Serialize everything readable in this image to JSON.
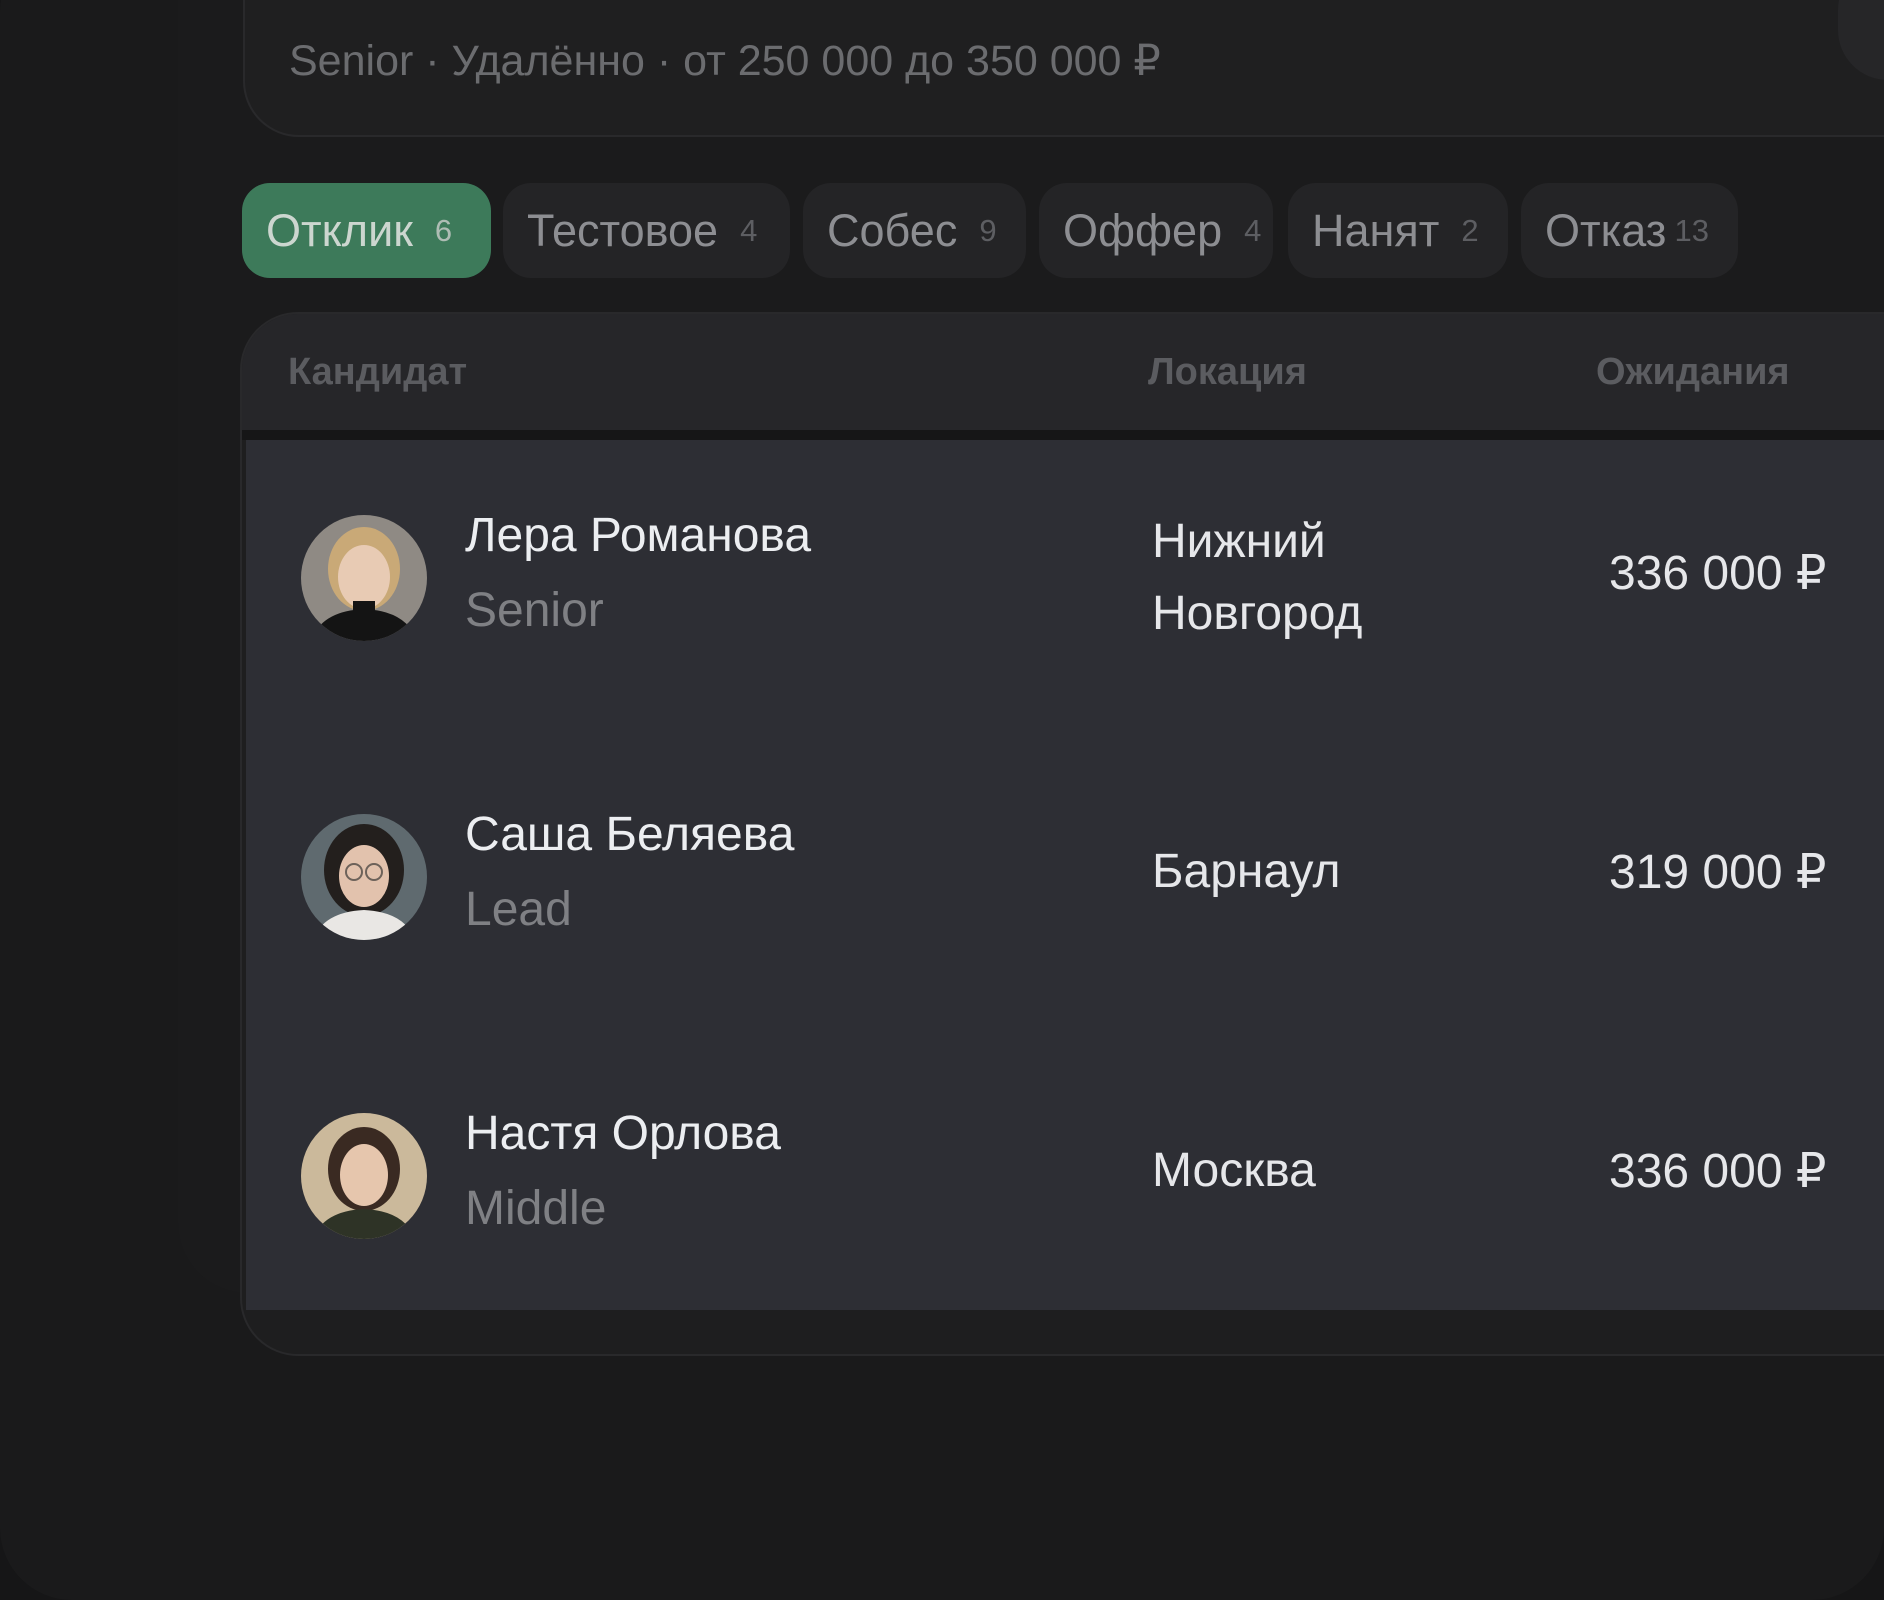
{
  "vacancy": {
    "meta": "Senior · Удалённо · от 250 000 до 350 000 ₽"
  },
  "tabs": [
    {
      "label": "Отклик",
      "count": "6",
      "active": true
    },
    {
      "label": "Тестовое",
      "count": "4"
    },
    {
      "label": "Собес",
      "count": "9"
    },
    {
      "label": "Оффер",
      "count": "4"
    },
    {
      "label": "Нанят",
      "count": "2"
    },
    {
      "label": "Отказ",
      "count": "13"
    }
  ],
  "table": {
    "headers": {
      "candidate": "Кандидат",
      "location": "Локация",
      "expectations": "Ожидания"
    },
    "rows": [
      {
        "name": "Лера Романова",
        "level": "Senior",
        "location": "Нижний Новгород",
        "salary": "336 000 ₽"
      },
      {
        "name": "Саша Беляева",
        "level": "Lead",
        "location": "Барнаул",
        "salary": "319 000 ₽"
      },
      {
        "name": "Настя Орлова",
        "level": "Middle",
        "location": "Москва",
        "salary": "336 000 ₽"
      }
    ]
  },
  "colors": {
    "accent": "#3d7a5a",
    "row_bg": "#2d2e34",
    "background": "#1a1a1b"
  }
}
